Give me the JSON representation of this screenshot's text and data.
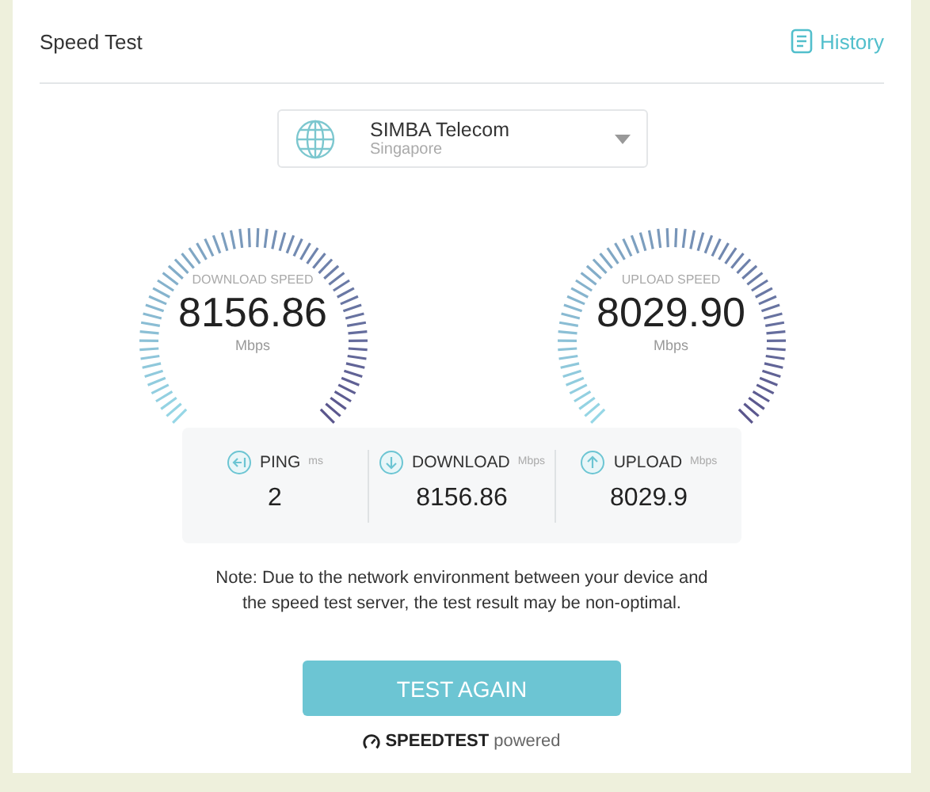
{
  "header": {
    "title": "Speed Test",
    "history": "History"
  },
  "server": {
    "name": "SIMBA Telecom",
    "location": "Singapore"
  },
  "gauges": [
    {
      "label": "DOWNLOAD SPEED",
      "value": "8156.86",
      "unit": "Mbps"
    },
    {
      "label": "UPLOAD SPEED",
      "value": "8029.90",
      "unit": "Mbps"
    }
  ],
  "stats": [
    {
      "kind": "ping",
      "label": "PING",
      "unit": "ms",
      "value": "2"
    },
    {
      "kind": "download",
      "label": "DOWNLOAD",
      "unit": "Mbps",
      "value": "8156.86"
    },
    {
      "kind": "upload",
      "label": "UPLOAD",
      "unit": "Mbps",
      "value": "8029.9"
    }
  ],
  "note": "Note: Due to the network environment between your device and the speed test server, the test result may be non-optimal.",
  "button": "TEST AGAIN",
  "powered": {
    "brand": "SPEEDTEST",
    "suffix": "powered"
  }
}
